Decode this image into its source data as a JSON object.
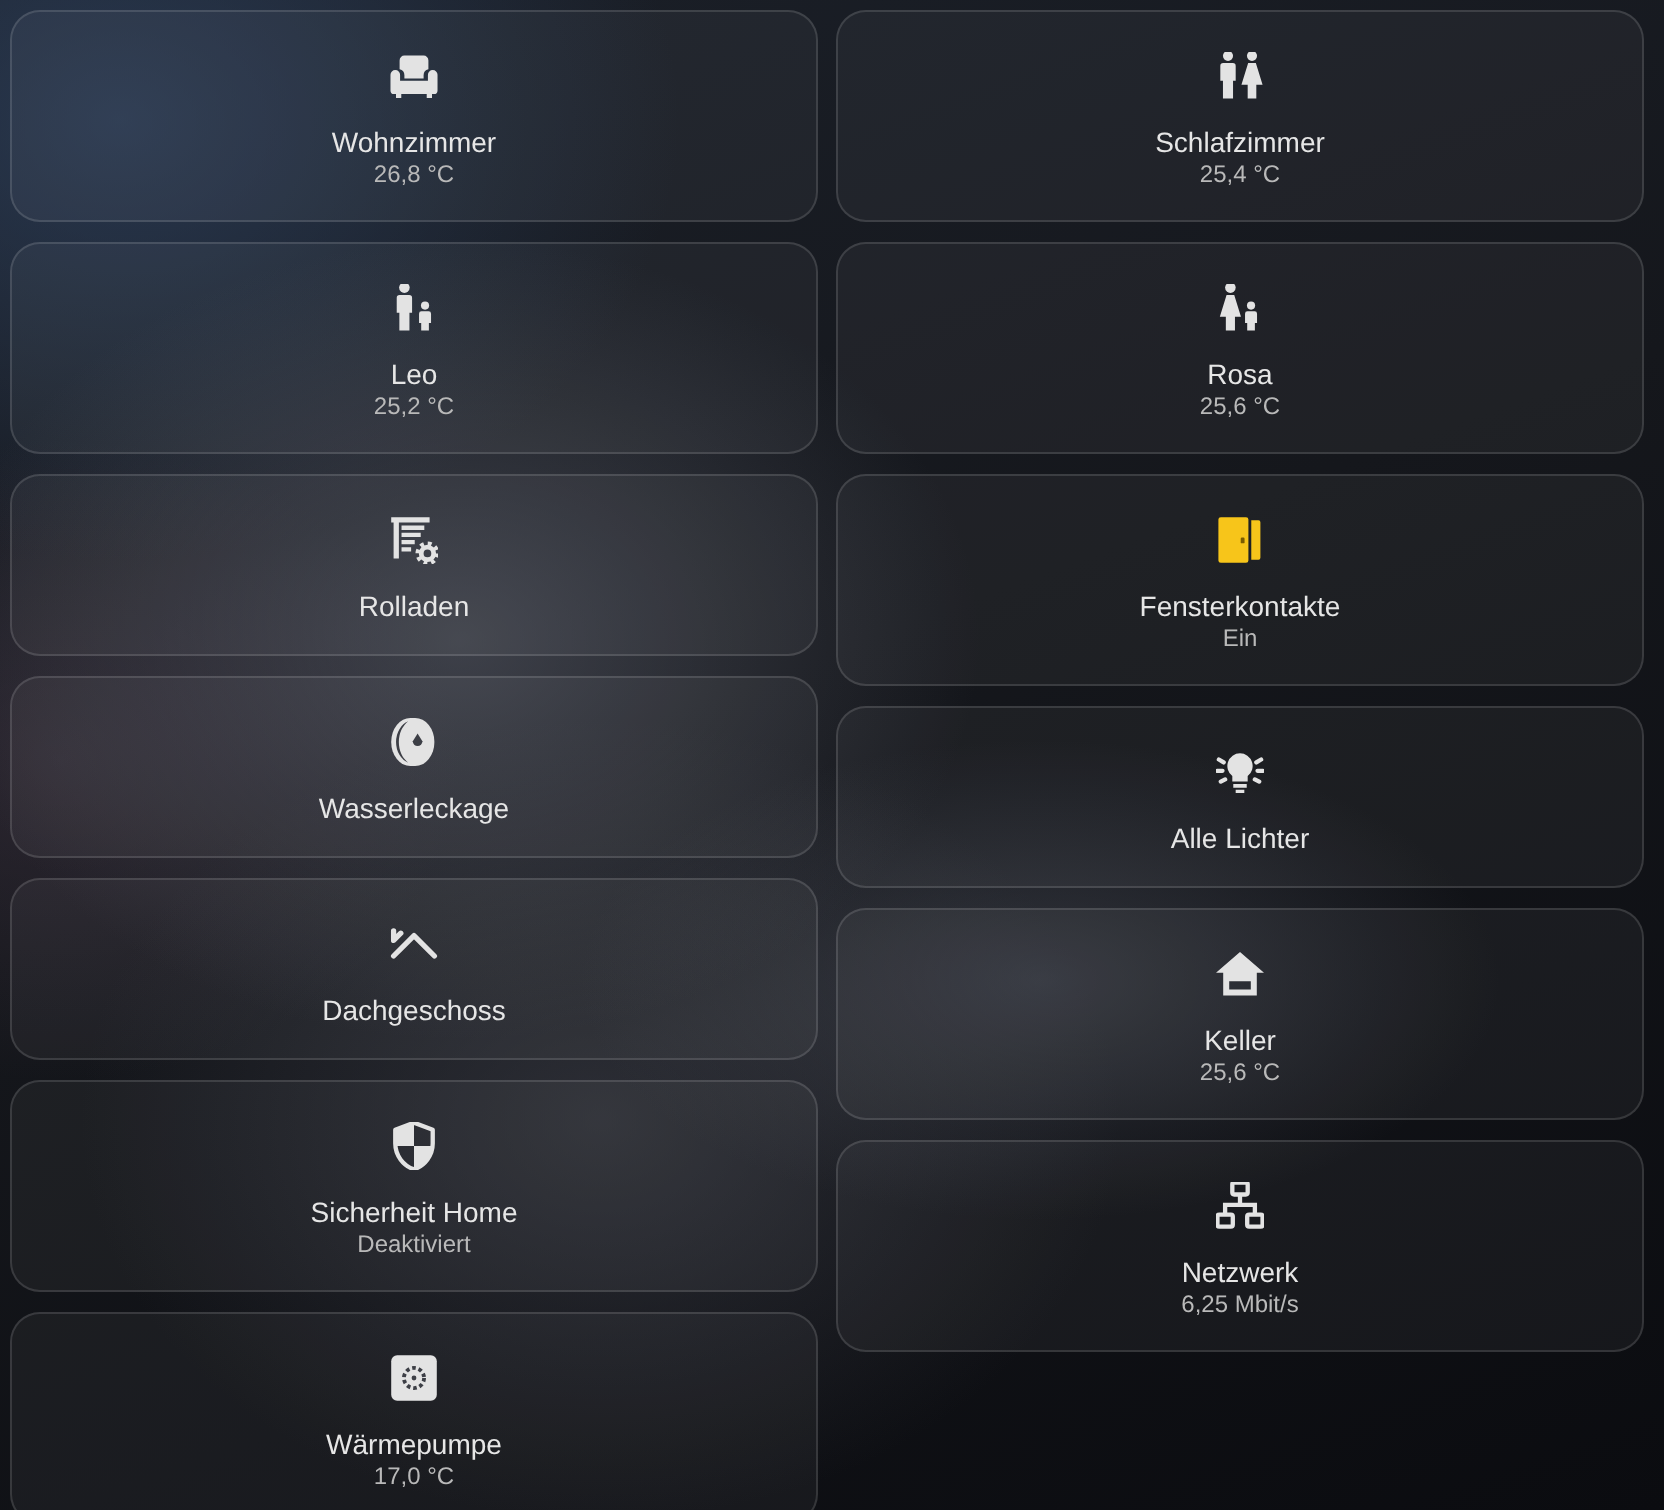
{
  "columns": [
    {
      "tiles": [
        {
          "kind": "livingroom",
          "name": "Wohnzimmer",
          "state": "26,8 °C",
          "active": false
        },
        {
          "kind": "boy",
          "name": "Leo",
          "state": "25,2 °C",
          "active": false
        },
        {
          "kind": "blinds",
          "name": "Rolladen",
          "active": false
        },
        {
          "kind": "leak",
          "name": "Wasserleckage",
          "active": false
        },
        {
          "kind": "attic",
          "name": "Dachgeschoss",
          "active": false
        },
        {
          "kind": "alarm",
          "name": "Sicherheit Home",
          "state": "Deaktiviert",
          "active": false
        },
        {
          "kind": "heatpump",
          "name": "Wärmepumpe",
          "state": "17,0 °C",
          "active": false
        }
      ]
    },
    {
      "tiles": [
        {
          "kind": "bedroom",
          "name": "Schlafzimmer",
          "state": "25,4 °C",
          "active": false
        },
        {
          "kind": "girl",
          "name": "Rosa",
          "state": "25,6 °C",
          "active": false
        },
        {
          "kind": "window",
          "name": "Fensterkontakte",
          "state": "Ein",
          "active": true
        },
        {
          "kind": "lights",
          "name": "Alle Lichter",
          "active": false
        },
        {
          "kind": "cellar",
          "name": "Keller",
          "state": "25,6 °C",
          "active": false
        },
        {
          "kind": "network",
          "name": "Netzwerk",
          "state": "6,25 Mbit/s",
          "active": false
        }
      ]
    }
  ]
}
